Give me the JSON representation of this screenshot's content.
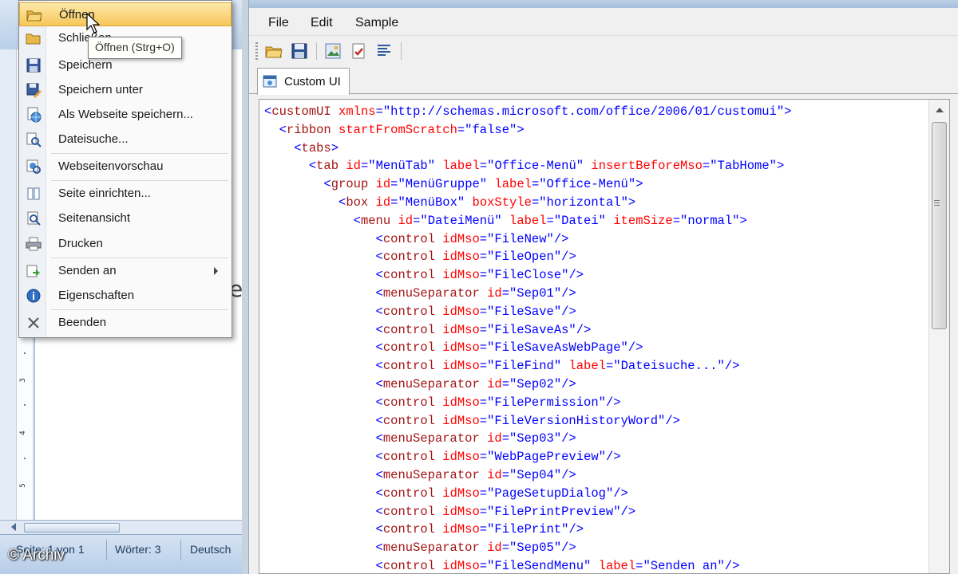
{
  "word": {
    "ruler_numbers": [
      "3",
      "4",
      "5"
    ],
    "page_edge_char": "e",
    "status": {
      "page": "Seite: 1 von 1",
      "words": "Wörter: 3",
      "language": "Deutsch"
    }
  },
  "watermark": "© Archiv",
  "file_menu": {
    "items": [
      {
        "label": "Öffnen",
        "icon": "open-folder-icon",
        "hovered": true
      },
      {
        "label": "Schließen",
        "icon": "close-folder-icon"
      },
      {
        "label": "Speichern",
        "icon": "save-disk-icon"
      },
      {
        "label": "Speichern unter",
        "icon": "save-as-icon"
      },
      {
        "label": "Als Webseite speichern...",
        "icon": "save-web-icon"
      },
      {
        "label": "Dateisuche...",
        "icon": "file-search-icon"
      },
      {
        "label": "Webseitenvorschau",
        "icon": "web-preview-icon"
      },
      {
        "label": "Seite einrichten...",
        "icon": "page-setup-icon"
      },
      {
        "label": "Seitenansicht",
        "icon": "print-preview-icon"
      },
      {
        "label": "Drucken",
        "icon": "printer-icon"
      },
      {
        "label": "Senden an",
        "icon": "send-to-icon",
        "submenu": true
      },
      {
        "label": "Eigenschaften",
        "icon": "properties-icon"
      },
      {
        "label": "Beenden",
        "icon": "close-x-icon"
      }
    ],
    "tooltip": "Öffnen (Strg+O)"
  },
  "editor": {
    "menu": {
      "file": "File",
      "edit": "Edit",
      "sample": "Sample"
    },
    "toolbar_icons": [
      "open-icon",
      "save-icon",
      "insert-icons-icon",
      "validate-icon",
      "generate-callbacks-icon"
    ],
    "tab_label": "Custom UI",
    "code": [
      {
        "indent": 0,
        "tag": "customUI",
        "attrs": [
          [
            "xmlns",
            "http://schemas.microsoft.com/office/2006/01/customui"
          ]
        ],
        "close": ">"
      },
      {
        "indent": 1,
        "tag": "ribbon",
        "attrs": [
          [
            "startFromScratch",
            "false"
          ]
        ],
        "close": ">"
      },
      {
        "indent": 2,
        "tag": "tabs",
        "attrs": [],
        "close": ">"
      },
      {
        "indent": 3,
        "tag": "tab",
        "attrs": [
          [
            "id",
            "MenüTab"
          ],
          [
            "label",
            "Office-Menü"
          ],
          [
            "insertBeforeMso",
            "TabHome"
          ]
        ],
        "close": ">"
      },
      {
        "indent": 4,
        "tag": "group",
        "attrs": [
          [
            "id",
            "MenüGruppe"
          ],
          [
            "label",
            "Office-Menü"
          ]
        ],
        "close": ">"
      },
      {
        "indent": 5,
        "tag": "box",
        "attrs": [
          [
            "id",
            "MenüBox"
          ],
          [
            "boxStyle",
            "horizontal"
          ]
        ],
        "close": ">"
      },
      {
        "indent": 6,
        "tag": "menu",
        "attrs": [
          [
            "id",
            "DateiMenü"
          ],
          [
            "label",
            "Datei"
          ],
          [
            "itemSize",
            "normal"
          ]
        ],
        "close": ">"
      },
      {
        "indent": 7,
        "tag": "control",
        "attrs": [
          [
            "idMso",
            "FileNew"
          ]
        ],
        "close": "/>"
      },
      {
        "indent": 7,
        "tag": "control",
        "attrs": [
          [
            "idMso",
            "FileOpen"
          ]
        ],
        "close": "/>"
      },
      {
        "indent": 7,
        "tag": "control",
        "attrs": [
          [
            "idMso",
            "FileClose"
          ]
        ],
        "close": "/>"
      },
      {
        "indent": 7,
        "tag": "menuSeparator",
        "attrs": [
          [
            "id",
            "Sep01"
          ]
        ],
        "close": "/>"
      },
      {
        "indent": 7,
        "tag": "control",
        "attrs": [
          [
            "idMso",
            "FileSave"
          ]
        ],
        "close": "/>"
      },
      {
        "indent": 7,
        "tag": "control",
        "attrs": [
          [
            "idMso",
            "FileSaveAs"
          ]
        ],
        "close": "/>"
      },
      {
        "indent": 7,
        "tag": "control",
        "attrs": [
          [
            "idMso",
            "FileSaveAsWebPage"
          ]
        ],
        "close": "/>"
      },
      {
        "indent": 7,
        "tag": "control",
        "attrs": [
          [
            "idMso",
            "FileFind"
          ],
          [
            "label",
            "Dateisuche..."
          ]
        ],
        "close": "/>"
      },
      {
        "indent": 7,
        "tag": "menuSeparator",
        "attrs": [
          [
            "id",
            "Sep02"
          ]
        ],
        "close": "/>"
      },
      {
        "indent": 7,
        "tag": "control",
        "attrs": [
          [
            "idMso",
            "FilePermission"
          ]
        ],
        "close": "/>"
      },
      {
        "indent": 7,
        "tag": "control",
        "attrs": [
          [
            "idMso",
            "FileVersionHistoryWord"
          ]
        ],
        "close": "/>"
      },
      {
        "indent": 7,
        "tag": "menuSeparator",
        "attrs": [
          [
            "id",
            "Sep03"
          ]
        ],
        "close": "/>"
      },
      {
        "indent": 7,
        "tag": "control",
        "attrs": [
          [
            "idMso",
            "WebPagePreview"
          ]
        ],
        "close": "/>"
      },
      {
        "indent": 7,
        "tag": "menuSeparator",
        "attrs": [
          [
            "id",
            "Sep04"
          ]
        ],
        "close": "/>"
      },
      {
        "indent": 7,
        "tag": "control",
        "attrs": [
          [
            "idMso",
            "PageSetupDialog"
          ]
        ],
        "close": "/>"
      },
      {
        "indent": 7,
        "tag": "control",
        "attrs": [
          [
            "idMso",
            "FilePrintPreview"
          ]
        ],
        "close": "/>"
      },
      {
        "indent": 7,
        "tag": "control",
        "attrs": [
          [
            "idMso",
            "FilePrint"
          ]
        ],
        "close": "/>"
      },
      {
        "indent": 7,
        "tag": "menuSeparator",
        "attrs": [
          [
            "id",
            "Sep05"
          ]
        ],
        "close": "/>"
      },
      {
        "indent": 7,
        "tag": "control",
        "attrs": [
          [
            "idMso",
            "FileSendMenu"
          ],
          [
            "label",
            "Senden an"
          ]
        ],
        "close": "/>"
      }
    ]
  },
  "colors": {
    "xml_tag": "#a31515",
    "xml_attr": "#ff0000",
    "xml_value": "#0000ff",
    "menu_highlight": "#f7c65a",
    "word_frame": "#8fb0d4"
  }
}
